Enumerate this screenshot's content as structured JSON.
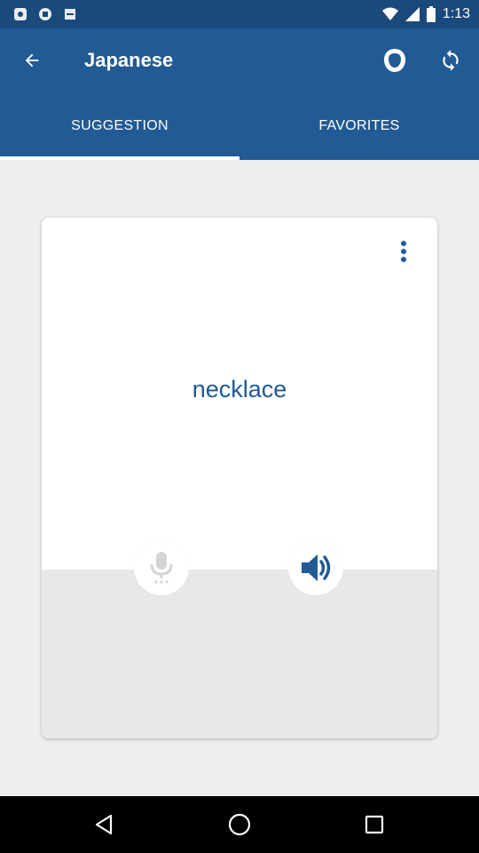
{
  "status_bar": {
    "time": "1:13",
    "icons": [
      "notification-icon",
      "notification-icon",
      "notification-icon",
      "wifi-icon",
      "signal-icon",
      "battery-icon"
    ]
  },
  "toolbar": {
    "title": "Japanese",
    "back_icon": "arrow-back-icon",
    "actions": [
      "face-icon",
      "refresh-icon"
    ]
  },
  "tabs": [
    {
      "label": "SUGGESTION",
      "active": true
    },
    {
      "label": "FAVORITES",
      "active": false
    }
  ],
  "card": {
    "word": "necklace",
    "menu_icon": "more-vert-icon",
    "buttons": [
      "microphone-icon",
      "speaker-icon"
    ]
  },
  "nav_bar": {
    "buttons": [
      "back-triangle-icon",
      "home-circle-icon",
      "recents-square-icon"
    ]
  },
  "colors": {
    "primary": "#215a94",
    "status": "#1a4a7c",
    "accent_text": "#215a94",
    "background": "#efefef"
  }
}
